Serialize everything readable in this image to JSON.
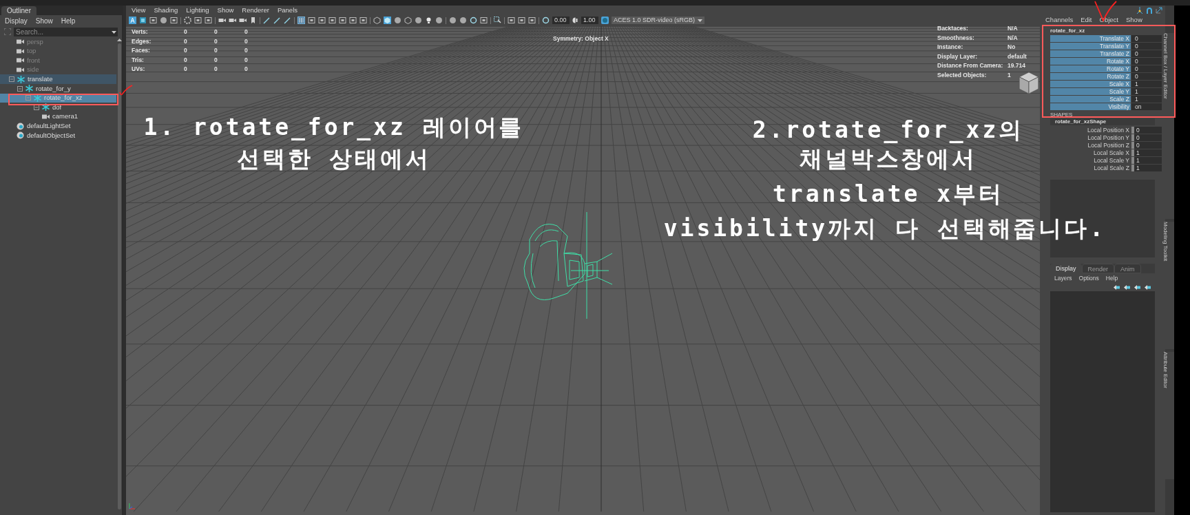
{
  "outliner": {
    "tab": "Outliner",
    "menu": [
      "Display",
      "Show",
      "Help"
    ],
    "search": {
      "placeholder": "Search..."
    },
    "items": [
      {
        "label": "persp",
        "kind": "camera",
        "hidden": true,
        "selected": false
      },
      {
        "label": "top",
        "kind": "camera",
        "hidden": true,
        "selected": false
      },
      {
        "label": "front",
        "kind": "camera",
        "hidden": true,
        "selected": false
      },
      {
        "label": "side",
        "kind": "camera",
        "hidden": true,
        "selected": false
      },
      {
        "label": "translate",
        "kind": "transform",
        "hidden": false,
        "selected": false,
        "highlighted": true,
        "expanded": true,
        "children": [
          {
            "label": "rotate_for_y",
            "kind": "transform",
            "hidden": false,
            "selected": false,
            "expanded": true,
            "children": [
              {
                "label": "rotate_for_xz",
                "kind": "transform",
                "hidden": false,
                "selected": true,
                "expanded": true,
                "children": [
                  {
                    "label": "dof",
                    "kind": "transform",
                    "hidden": false,
                    "selected": false,
                    "expanded": true,
                    "children": [
                      {
                        "label": "camera1",
                        "kind": "camera",
                        "hidden": false,
                        "selected": false
                      }
                    ]
                  }
                ]
              }
            ]
          }
        ]
      },
      {
        "label": "defaultLightSet",
        "kind": "set",
        "hidden": false,
        "selected": false
      },
      {
        "label": "defaultObjectSet",
        "kind": "set",
        "hidden": false,
        "selected": false
      }
    ]
  },
  "viewport": {
    "menu": [
      "View",
      "Shading",
      "Lighting",
      "Show",
      "Renderer",
      "Panels"
    ],
    "toolbar": {
      "exposure": "0.00",
      "gamma": "1.00",
      "color_space": "ACES 1.0 SDR-video (sRGB)"
    },
    "hud_left": [
      {
        "label": "Verts:",
        "values": [
          "0",
          "0",
          "0"
        ]
      },
      {
        "label": "Edges:",
        "values": [
          "0",
          "0",
          "0"
        ]
      },
      {
        "label": "Faces:",
        "values": [
          "0",
          "0",
          "0"
        ]
      },
      {
        "label": "Tris:",
        "values": [
          "0",
          "0",
          "0"
        ]
      },
      {
        "label": "UVs:",
        "values": [
          "0",
          "0",
          "0"
        ]
      }
    ],
    "symmetry": "Symmetry: Object X",
    "hud_right": [
      {
        "label": "Backfaces:",
        "value": "N/A"
      },
      {
        "label": "Smoothness:",
        "value": "N/A"
      },
      {
        "label": "Instance:",
        "value": "No"
      },
      {
        "label": "Display Layer:",
        "value": "default"
      },
      {
        "label": "Distance From Camera:",
        "value": "19.714"
      },
      {
        "label": "Selected Objects:",
        "value": "1"
      }
    ]
  },
  "channel_box": {
    "menu": [
      "Channels",
      "Edit",
      "Object",
      "Show"
    ],
    "object": "rotate_for_xz",
    "channels": [
      {
        "name": "Translate X",
        "value": "0",
        "selected": true
      },
      {
        "name": "Translate Y",
        "value": "0",
        "selected": true
      },
      {
        "name": "Translate Z",
        "value": "0",
        "selected": true
      },
      {
        "name": "Rotate X",
        "value": "0",
        "selected": true
      },
      {
        "name": "Rotate Y",
        "value": "0",
        "selected": true
      },
      {
        "name": "Rotate Z",
        "value": "0",
        "selected": true
      },
      {
        "name": "Scale X",
        "value": "1",
        "selected": true
      },
      {
        "name": "Scale Y",
        "value": "1",
        "selected": true
      },
      {
        "name": "Scale Z",
        "value": "1",
        "selected": true
      },
      {
        "name": "Visibility",
        "value": "on",
        "selected": true
      }
    ],
    "shapes_heading": "SHAPES",
    "shape": "rotate_for_xzShape",
    "shape_channels": [
      {
        "name": "Local Position X",
        "value": "0",
        "selected": false
      },
      {
        "name": "Local Position Y",
        "value": "0",
        "selected": false
      },
      {
        "name": "Local Position Z",
        "value": "0",
        "selected": false
      },
      {
        "name": "Local Scale X",
        "value": "1",
        "selected": false
      },
      {
        "name": "Local Scale Y",
        "value": "1",
        "selected": false
      },
      {
        "name": "Local Scale Z",
        "value": "1",
        "selected": false
      }
    ]
  },
  "layer_editor": {
    "tabs": [
      {
        "label": "Display",
        "selected": true
      },
      {
        "label": "Render",
        "selected": false
      },
      {
        "label": "Anim",
        "selected": false
      }
    ],
    "menu": [
      "Layers",
      "Options",
      "Help"
    ]
  },
  "side_tabs": [
    "Channel Box / Layer Editor",
    "Modeling Toolkit",
    "Attribute Editor"
  ],
  "annotations": [
    {
      "lines": [
        "1. rotate_for_xz 레이어를",
        "선택한 상태에서"
      ]
    },
    {
      "lines": [
        "2.rotate_for_xz의",
        "채널박스창에서",
        "translate x부터",
        "visibility까지 다 선택해줍니다."
      ]
    }
  ]
}
